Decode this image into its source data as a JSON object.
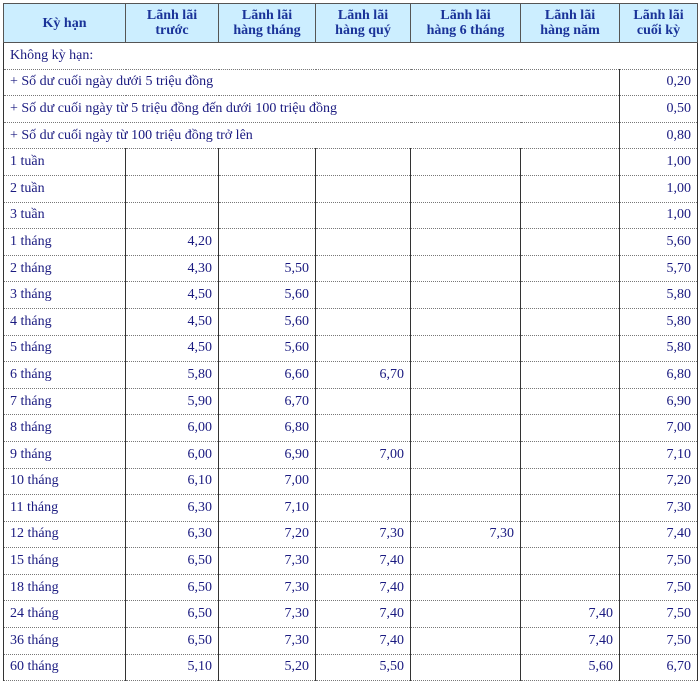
{
  "headers": [
    [
      "Kỳ hạn",
      ""
    ],
    [
      "Lãnh lãi",
      "trước"
    ],
    [
      "Lãnh lãi",
      "hàng tháng"
    ],
    [
      "Lãnh lãi",
      "hàng quý"
    ],
    [
      "Lãnh lãi",
      "hàng 6 tháng"
    ],
    [
      "Lãnh lãi",
      "hàng năm"
    ],
    [
      "Lãnh lãi",
      "cuối kỳ"
    ]
  ],
  "section_title": "Không kỳ hạn:",
  "no_term_rows": [
    {
      "label": "+ Số dư cuối ngày dưới 5 triệu đồng",
      "rate": "0,20"
    },
    {
      "label": "+ Số dư cuối ngày từ 5 triệu đồng đến dưới 100 triệu đồng",
      "rate": "0,50"
    },
    {
      "label": "+ Số dư cuối ngày từ 100 triệu đồng trở lên",
      "rate": "0,80"
    }
  ],
  "rows": [
    [
      "1 tuần",
      "",
      "",
      "",
      "",
      "",
      "1,00"
    ],
    [
      "2 tuần",
      "",
      "",
      "",
      "",
      "",
      "1,00"
    ],
    [
      "3 tuần",
      "",
      "",
      "",
      "",
      "",
      "1,00"
    ],
    [
      "1 tháng",
      "4,20",
      "",
      "",
      "",
      "",
      "5,60"
    ],
    [
      "2 tháng",
      "4,30",
      "5,50",
      "",
      "",
      "",
      "5,70"
    ],
    [
      "3 tháng",
      "4,50",
      "5,60",
      "",
      "",
      "",
      "5,80"
    ],
    [
      "4 tháng",
      "4,50",
      "5,60",
      "",
      "",
      "",
      "5,80"
    ],
    [
      "5 tháng",
      "4,50",
      "5,60",
      "",
      "",
      "",
      "5,80"
    ],
    [
      "6 tháng",
      "5,80",
      "6,60",
      "6,70",
      "",
      "",
      "6,80"
    ],
    [
      "7 tháng",
      "5,90",
      "6,70",
      "",
      "",
      "",
      "6,90"
    ],
    [
      "8 tháng",
      "6,00",
      "6,80",
      "",
      "",
      "",
      "7,00"
    ],
    [
      "9 tháng",
      "6,00",
      "6,90",
      "7,00",
      "",
      "",
      "7,10"
    ],
    [
      "10 tháng",
      "6,10",
      "7,00",
      "",
      "",
      "",
      "7,20"
    ],
    [
      "11 tháng",
      "6,30",
      "7,10",
      "",
      "",
      "",
      "7,30"
    ],
    [
      "12 tháng",
      "6,30",
      "7,20",
      "7,30",
      "7,30",
      "",
      "7,40"
    ],
    [
      "15 tháng",
      "6,50",
      "7,30",
      "7,40",
      "",
      "",
      "7,50"
    ],
    [
      "18 tháng",
      "6,50",
      "7,30",
      "7,40",
      "",
      "",
      "7,50"
    ],
    [
      "24 tháng",
      "6,50",
      "7,30",
      "7,40",
      "",
      "7,40",
      "7,50"
    ],
    [
      "36 tháng",
      "6,50",
      "7,30",
      "7,40",
      "",
      "7,40",
      "7,50"
    ],
    [
      "60 tháng",
      "5,10",
      "5,20",
      "5,50",
      "",
      "5,60",
      "6,70"
    ]
  ],
  "colors": {
    "header_bg": "#cceeff",
    "header_text": "#1a3399",
    "body_text": "#1a1a80"
  }
}
